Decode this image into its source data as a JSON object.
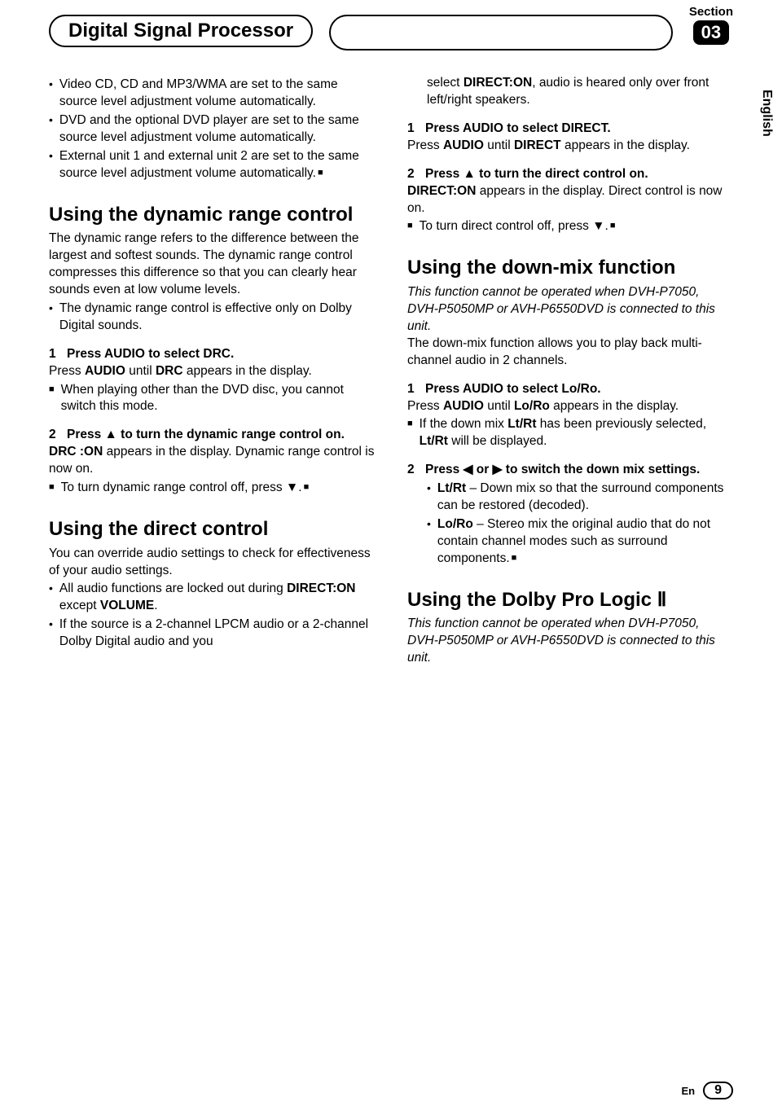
{
  "header": {
    "title": "Digital Signal Processor",
    "section_label": "Section",
    "section_num": "03"
  },
  "side_tab": "English",
  "col1": {
    "b1": "Video CD, CD and MP3/WMA are set to the same source level adjustment volume automatically.",
    "b2": "DVD and the optional DVD player are set to the same source level adjustment volume automatically.",
    "b3": "External unit 1 and external unit 2 are set to the same source level adjustment volume automatically.",
    "h_drc": "Using the dynamic range control",
    "drc_p1": "The dynamic range refers to the difference between the largest and softest sounds. The dynamic range control compresses this difference so that you can clearly hear sounds even at low volume levels.",
    "drc_b1": "The dynamic range control is effective only on Dolby Digital sounds.",
    "drc_s1_label": "Press AUDIO to select DRC.",
    "drc_s1_body_a": "Press ",
    "drc_s1_body_b": "AUDIO",
    "drc_s1_body_c": " until ",
    "drc_s1_body_d": "DRC",
    "drc_s1_body_e": " appears in the display.",
    "drc_s1_note": "When playing other than the DVD disc, you cannot switch this mode.",
    "drc_s2_label": "Press ▲ to turn the dynamic range control on.",
    "drc_s2_body_a": "DRC :ON",
    "drc_s2_body_b": " appears in the display. Dynamic range control is now on.",
    "drc_s2_note": "To turn dynamic range control off, press ▼.",
    "h_direct": "Using the direct control",
    "direct_p1": "You can override audio settings to check for effectiveness of your audio settings.",
    "direct_b1_a": "All audio functions are locked out during ",
    "direct_b1_b": "DIRECT:ON",
    "direct_b1_c": " except ",
    "direct_b1_d": "VOLUME",
    "direct_b1_e": ".",
    "direct_b2": "If the source is a 2-channel LPCM audio or a 2-channel Dolby Digital audio and you"
  },
  "col2": {
    "cont_a": "select ",
    "cont_b": "DIRECT:ON",
    "cont_c": ", audio is heared only over front left/right speakers.",
    "d_s1_label": "Press AUDIO to select DIRECT.",
    "d_s1_body_a": "Press ",
    "d_s1_body_b": "AUDIO",
    "d_s1_body_c": " until ",
    "d_s1_body_d": "DIRECT",
    "d_s1_body_e": " appears in the display.",
    "d_s2_label": "Press ▲ to turn the direct control on.",
    "d_s2_body_a": "DIRECT:ON",
    "d_s2_body_b": " appears in the display. Direct control is now on.",
    "d_s2_note": "To turn direct control off, press ▼.",
    "h_dm": "Using the down-mix function",
    "dm_it": "This function cannot be operated when DVH-P7050, DVH-P5050MP or AVH-P6550DVD is connected to this unit.",
    "dm_p1": "The down-mix function allows you to play back multi-channel audio in 2 channels.",
    "dm_s1_label": "Press AUDIO to select Lo/Ro.",
    "dm_s1_body_a": "Press ",
    "dm_s1_body_b": "AUDIO",
    "dm_s1_body_c": " until ",
    "dm_s1_body_d": "Lo/Ro",
    "dm_s1_body_e": " appears in the display.",
    "dm_s1_note_a": "If the down mix ",
    "dm_s1_note_b": "Lt/Rt",
    "dm_s1_note_c": " has been previously selected, ",
    "dm_s1_note_d": "Lt/Rt",
    "dm_s1_note_e": " will be displayed.",
    "dm_s2_label": "Press ◀ or ▶ to switch the down mix settings.",
    "dm_b1_a": "Lt/Rt",
    "dm_b1_b": " – Down mix so that the surround components can be restored (decoded).",
    "dm_b2_a": "Lo/Ro",
    "dm_b2_b": " – Stereo mix the original audio that do not contain channel modes such as surround components.",
    "h_dpl": "Using the Dolby Pro Logic Ⅱ",
    "dpl_it": "This function cannot be operated when DVH-P7050, DVH-P5050MP or AVH-P6550DVD is connected to this unit."
  },
  "footer": {
    "lang": "En",
    "page": "9"
  }
}
